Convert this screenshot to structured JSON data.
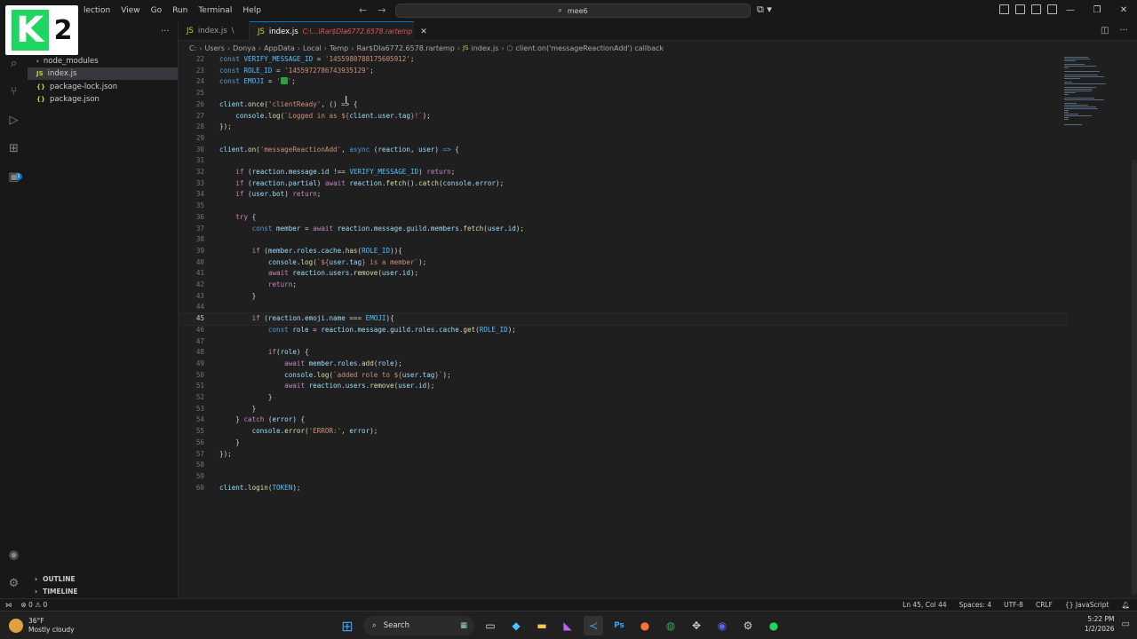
{
  "titlebar": {
    "menu": [
      "lection",
      "View",
      "Go",
      "Run",
      "Terminal",
      "Help"
    ],
    "search_text": "mee6",
    "logo_letter": "K",
    "logo_number": "2"
  },
  "sidebar": {
    "items": [
      {
        "label": "node_modules",
        "type": "folder"
      },
      {
        "label": "index.js",
        "type": "js"
      },
      {
        "label": "package-lock.json",
        "type": "json"
      },
      {
        "label": "package.json",
        "type": "json"
      }
    ],
    "outline": "OUTLINE",
    "timeline": "TIMELINE"
  },
  "tabs": {
    "inactive": {
      "label": "index.js",
      "suffix": "\\"
    },
    "active": {
      "label": "index.js",
      "path": "C:\\...\\Rar$DIa6772.6578.rartemp"
    }
  },
  "breadcrumb": [
    "C:",
    "Users",
    "Donya",
    "AppData",
    "Local",
    "Temp",
    "Rar$DIa6772.6578.rartemp",
    "index.js",
    "client.on('messageReactionAdd') callback"
  ],
  "editor": {
    "current_line": 45,
    "lines": [
      {
        "n": "22",
        "tokens": [
          [
            "kw",
            "const "
          ],
          [
            "cst",
            "VERIFY_MESSAGE_ID"
          ],
          [
            "op",
            " = "
          ],
          [
            "str",
            "'1455980788175605912'"
          ],
          [
            "op",
            ";"
          ]
        ]
      },
      {
        "n": "23",
        "tokens": [
          [
            "kw",
            "const "
          ],
          [
            "cst",
            "ROLE_ID"
          ],
          [
            "op",
            " = "
          ],
          [
            "str",
            "'1455972786743935129'"
          ],
          [
            "op",
            ";"
          ]
        ]
      },
      {
        "n": "24",
        "tokens": [
          [
            "kw",
            "const "
          ],
          [
            "cst",
            "EMOJI"
          ],
          [
            "op",
            " = "
          ],
          [
            "str",
            "'"
          ],
          [
            "emoji",
            "✅"
          ],
          [
            "str",
            "'"
          ],
          [
            "op",
            ";"
          ]
        ]
      },
      {
        "n": "25",
        "tokens": []
      },
      {
        "n": "26",
        "tokens": [
          [
            "var",
            "client"
          ],
          [
            "op",
            "."
          ],
          [
            "fn",
            "once"
          ],
          [
            "op",
            "("
          ],
          [
            "str",
            "'clientReady'"
          ],
          [
            "op",
            ", () => {"
          ]
        ]
      },
      {
        "n": "27",
        "tokens": [
          [
            "op",
            "    "
          ],
          [
            "var",
            "console"
          ],
          [
            "op",
            "."
          ],
          [
            "fn",
            "log"
          ],
          [
            "op",
            "("
          ],
          [
            "str",
            "`Logged in as ${"
          ],
          [
            "var",
            "client"
          ],
          [
            "op",
            "."
          ],
          [
            "var",
            "user"
          ],
          [
            "op",
            "."
          ],
          [
            "var",
            "tag"
          ],
          [
            "str",
            "}!`"
          ],
          [
            "op",
            ");"
          ]
        ]
      },
      {
        "n": "28",
        "tokens": [
          [
            "op",
            "});"
          ]
        ]
      },
      {
        "n": "29",
        "tokens": []
      },
      {
        "n": "30",
        "tokens": [
          [
            "var",
            "client"
          ],
          [
            "op",
            "."
          ],
          [
            "fn",
            "on"
          ],
          [
            "op",
            "("
          ],
          [
            "str",
            "'messageReactionAdd'"
          ],
          [
            "op",
            ", "
          ],
          [
            "kw",
            "async "
          ],
          [
            "op",
            "("
          ],
          [
            "var",
            "reaction"
          ],
          [
            "op",
            ", "
          ],
          [
            "var",
            "user"
          ],
          [
            "op",
            ") "
          ],
          [
            "kw",
            "=>"
          ],
          [
            "op",
            " {"
          ]
        ]
      },
      {
        "n": "31",
        "tokens": []
      },
      {
        "n": "32",
        "tokens": [
          [
            "op",
            "    "
          ],
          [
            "ctl",
            "if"
          ],
          [
            "op",
            " ("
          ],
          [
            "var",
            "reaction"
          ],
          [
            "op",
            "."
          ],
          [
            "var",
            "message"
          ],
          [
            "op",
            "."
          ],
          [
            "var",
            "id"
          ],
          [
            "op",
            " !== "
          ],
          [
            "cst",
            "VERIFY_MESSAGE_ID"
          ],
          [
            "op",
            ") "
          ],
          [
            "ctl",
            "return"
          ],
          [
            "op",
            ";"
          ]
        ]
      },
      {
        "n": "33",
        "tokens": [
          [
            "op",
            "    "
          ],
          [
            "ctl",
            "if"
          ],
          [
            "op",
            " ("
          ],
          [
            "var",
            "reaction"
          ],
          [
            "op",
            "."
          ],
          [
            "var",
            "partial"
          ],
          [
            "op",
            ") "
          ],
          [
            "ctl",
            "await "
          ],
          [
            "var",
            "reaction"
          ],
          [
            "op",
            "."
          ],
          [
            "fn",
            "fetch"
          ],
          [
            "op",
            "()."
          ],
          [
            "fn",
            "catch"
          ],
          [
            "op",
            "("
          ],
          [
            "var",
            "console"
          ],
          [
            "op",
            "."
          ],
          [
            "var",
            "error"
          ],
          [
            "op",
            ");"
          ]
        ]
      },
      {
        "n": "34",
        "tokens": [
          [
            "op",
            "    "
          ],
          [
            "ctl",
            "if"
          ],
          [
            "op",
            " ("
          ],
          [
            "var",
            "user"
          ],
          [
            "op",
            "."
          ],
          [
            "var",
            "bot"
          ],
          [
            "op",
            ") "
          ],
          [
            "ctl",
            "return"
          ],
          [
            "op",
            ";"
          ]
        ]
      },
      {
        "n": "35",
        "tokens": []
      },
      {
        "n": "36",
        "tokens": [
          [
            "op",
            "    "
          ],
          [
            "ctl",
            "try"
          ],
          [
            "op",
            " {"
          ]
        ]
      },
      {
        "n": "37",
        "tokens": [
          [
            "op",
            "        "
          ],
          [
            "kw",
            "const "
          ],
          [
            "var",
            "member"
          ],
          [
            "op",
            " = "
          ],
          [
            "ctl",
            "await "
          ],
          [
            "var",
            "reaction"
          ],
          [
            "op",
            "."
          ],
          [
            "var",
            "message"
          ],
          [
            "op",
            "."
          ],
          [
            "var",
            "guild"
          ],
          [
            "op",
            "."
          ],
          [
            "var",
            "members"
          ],
          [
            "op",
            "."
          ],
          [
            "fn",
            "fetch"
          ],
          [
            "op",
            "("
          ],
          [
            "var",
            "user"
          ],
          [
            "op",
            "."
          ],
          [
            "var",
            "id"
          ],
          [
            "op",
            ");"
          ]
        ]
      },
      {
        "n": "38",
        "tokens": []
      },
      {
        "n": "39",
        "tokens": [
          [
            "op",
            "        "
          ],
          [
            "ctl",
            "if"
          ],
          [
            "op",
            " ("
          ],
          [
            "var",
            "member"
          ],
          [
            "op",
            "."
          ],
          [
            "var",
            "roles"
          ],
          [
            "op",
            "."
          ],
          [
            "var",
            "cache"
          ],
          [
            "op",
            "."
          ],
          [
            "fn",
            "has"
          ],
          [
            "op",
            "("
          ],
          [
            "cst",
            "ROLE_ID"
          ],
          [
            "op",
            "))"
          ],
          [
            "op",
            "{"
          ]
        ]
      },
      {
        "n": "40",
        "tokens": [
          [
            "op",
            "            "
          ],
          [
            "var",
            "console"
          ],
          [
            "op",
            "."
          ],
          [
            "fn",
            "log"
          ],
          [
            "op",
            "("
          ],
          [
            "str",
            "`${"
          ],
          [
            "var",
            "user"
          ],
          [
            "op",
            "."
          ],
          [
            "var",
            "tag"
          ],
          [
            "str",
            "} is a member`"
          ],
          [
            "op",
            ");"
          ]
        ]
      },
      {
        "n": "41",
        "tokens": [
          [
            "op",
            "            "
          ],
          [
            "ctl",
            "await "
          ],
          [
            "var",
            "reaction"
          ],
          [
            "op",
            "."
          ],
          [
            "var",
            "users"
          ],
          [
            "op",
            "."
          ],
          [
            "fn",
            "remove"
          ],
          [
            "op",
            "("
          ],
          [
            "var",
            "user"
          ],
          [
            "op",
            "."
          ],
          [
            "var",
            "id"
          ],
          [
            "op",
            ");"
          ]
        ]
      },
      {
        "n": "42",
        "tokens": [
          [
            "op",
            "            "
          ],
          [
            "ctl",
            "return"
          ],
          [
            "op",
            ";"
          ]
        ]
      },
      {
        "n": "43",
        "tokens": [
          [
            "op",
            "        }"
          ]
        ]
      },
      {
        "n": "44",
        "tokens": []
      },
      {
        "n": "45",
        "tokens": [
          [
            "op",
            "        "
          ],
          [
            "ctl",
            "if"
          ],
          [
            "op",
            " ("
          ],
          [
            "var",
            "reaction"
          ],
          [
            "op",
            "."
          ],
          [
            "var",
            "emoji"
          ],
          [
            "op",
            "."
          ],
          [
            "var",
            "name"
          ],
          [
            "op",
            " === "
          ],
          [
            "cst",
            "EMOJI"
          ],
          [
            "op",
            "){"
          ]
        ]
      },
      {
        "n": "46",
        "tokens": [
          [
            "op",
            "            "
          ],
          [
            "kw",
            "const "
          ],
          [
            "var",
            "role"
          ],
          [
            "op",
            " = "
          ],
          [
            "var",
            "reaction"
          ],
          [
            "op",
            "."
          ],
          [
            "var",
            "message"
          ],
          [
            "op",
            "."
          ],
          [
            "var",
            "guild"
          ],
          [
            "op",
            "."
          ],
          [
            "var",
            "roles"
          ],
          [
            "op",
            "."
          ],
          [
            "var",
            "cache"
          ],
          [
            "op",
            "."
          ],
          [
            "fn",
            "get"
          ],
          [
            "op",
            "("
          ],
          [
            "cst",
            "ROLE_ID"
          ],
          [
            "op",
            ");"
          ]
        ]
      },
      {
        "n": "47",
        "tokens": []
      },
      {
        "n": "48",
        "tokens": [
          [
            "op",
            "            "
          ],
          [
            "ctl",
            "if"
          ],
          [
            "op",
            "("
          ],
          [
            "var",
            "role"
          ],
          [
            "op",
            ") {"
          ]
        ]
      },
      {
        "n": "49",
        "tokens": [
          [
            "op",
            "                "
          ],
          [
            "ctl",
            "await "
          ],
          [
            "var",
            "member"
          ],
          [
            "op",
            "."
          ],
          [
            "var",
            "roles"
          ],
          [
            "op",
            "."
          ],
          [
            "fn",
            "add"
          ],
          [
            "op",
            "("
          ],
          [
            "var",
            "role"
          ],
          [
            "op",
            ");"
          ]
        ]
      },
      {
        "n": "50",
        "tokens": [
          [
            "op",
            "                "
          ],
          [
            "var",
            "console"
          ],
          [
            "op",
            "."
          ],
          [
            "fn",
            "log"
          ],
          [
            "op",
            "("
          ],
          [
            "str",
            "`added role to ${"
          ],
          [
            "var",
            "user"
          ],
          [
            "op",
            "."
          ],
          [
            "var",
            "tag"
          ],
          [
            "str",
            "}`"
          ],
          [
            "op",
            ");"
          ]
        ]
      },
      {
        "n": "51",
        "tokens": [
          [
            "op",
            "                "
          ],
          [
            "ctl",
            "await "
          ],
          [
            "var",
            "reaction"
          ],
          [
            "op",
            "."
          ],
          [
            "var",
            "users"
          ],
          [
            "op",
            "."
          ],
          [
            "fn",
            "remove"
          ],
          [
            "op",
            "("
          ],
          [
            "var",
            "user"
          ],
          [
            "op",
            "."
          ],
          [
            "var",
            "id"
          ],
          [
            "op",
            ");"
          ]
        ]
      },
      {
        "n": "52",
        "tokens": [
          [
            "op",
            "            }"
          ]
        ]
      },
      {
        "n": "53",
        "tokens": [
          [
            "op",
            "        }"
          ]
        ]
      },
      {
        "n": "54",
        "tokens": [
          [
            "op",
            "    } "
          ],
          [
            "ctl",
            "catch"
          ],
          [
            "op",
            " ("
          ],
          [
            "var",
            "error"
          ],
          [
            "op",
            ") {"
          ]
        ]
      },
      {
        "n": "55",
        "tokens": [
          [
            "op",
            "        "
          ],
          [
            "var",
            "console"
          ],
          [
            "op",
            "."
          ],
          [
            "fn",
            "error"
          ],
          [
            "op",
            "("
          ],
          [
            "str",
            "'ERROR:'"
          ],
          [
            "op",
            ", "
          ],
          [
            "var",
            "error"
          ],
          [
            "op",
            ");"
          ]
        ]
      },
      {
        "n": "56",
        "tokens": [
          [
            "op",
            "    }"
          ]
        ]
      },
      {
        "n": "57",
        "tokens": [
          [
            "op",
            "});"
          ]
        ]
      },
      {
        "n": "58",
        "tokens": []
      },
      {
        "n": "59",
        "tokens": []
      },
      {
        "n": "60",
        "tokens": [
          [
            "var",
            "client"
          ],
          [
            "op",
            "."
          ],
          [
            "fn",
            "login"
          ],
          [
            "op",
            "("
          ],
          [
            "cst",
            "TOKEN"
          ],
          [
            "op",
            ");"
          ]
        ]
      }
    ]
  },
  "statusbar": {
    "errors": "0",
    "warnings": "0",
    "position": "Ln 45, Col 44",
    "spaces": "Spaces: 4",
    "encoding": "UTF-8",
    "eol": "CRLF",
    "language": "JavaScript"
  },
  "taskbar": {
    "temperature": "36°F",
    "weather": "Mostly cloudy",
    "search_label": "Search",
    "time": "5:22 PM",
    "date": "1/2/2026"
  },
  "colors": {
    "accent": "#0078d4",
    "keyword": "#569cd6",
    "control": "#c586c0",
    "variable": "#9cdcfe",
    "constant": "#4fc1ff",
    "function": "#dcdcaa",
    "string": "#ce9178"
  }
}
